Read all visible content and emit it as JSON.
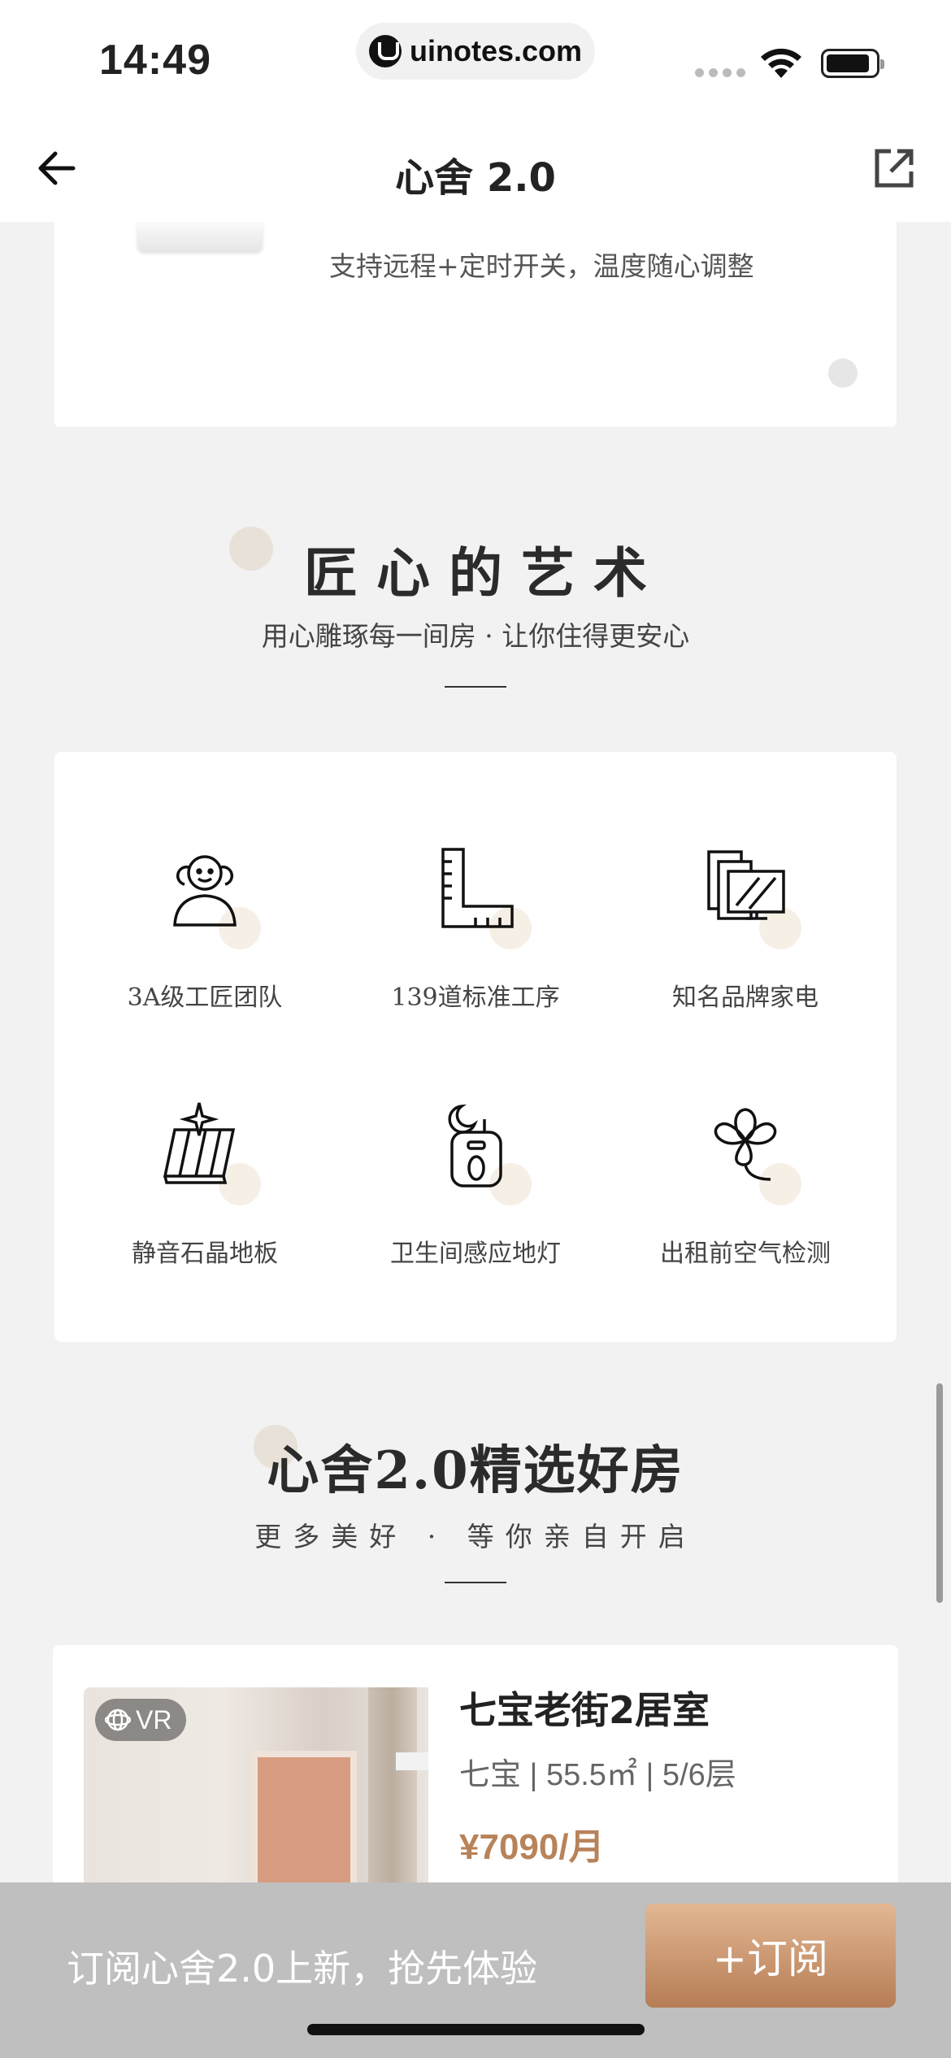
{
  "status_bar": {
    "time": "14:49",
    "url": "uinotes.com"
  },
  "nav": {
    "title": "心舍 2.0"
  },
  "ac_card": {
    "description": "支持远程+定时开关，温度随心调整"
  },
  "craft_section": {
    "title": "匠 心 的 艺 术",
    "subtitle": "用心雕琢每一间房 · 让你住得更安心"
  },
  "features": [
    {
      "label": "3A级工匠团队",
      "icon": "team-icon"
    },
    {
      "label": "139道标准工序",
      "icon": "ruler-icon"
    },
    {
      "label": "知名品牌家电",
      "icon": "appliance-icon"
    },
    {
      "label": "静音石晶地板",
      "icon": "floor-icon"
    },
    {
      "label": "卫生间感应地灯",
      "icon": "night-light-icon"
    },
    {
      "label": "出租前空气检测",
      "icon": "clover-icon"
    }
  ],
  "listings_section": {
    "title": "心舍2.0精选好房",
    "subtitle": "更多美好 · 等你亲自开启"
  },
  "listing": {
    "badge": "VR",
    "name": "七宝老街2居室",
    "meta": "七宝 | 55.5㎡ | 5/6层",
    "price": "¥7090/月"
  },
  "subscribe_bar": {
    "text": "订阅心舍2.0上新，抢先体验",
    "button": "+订阅"
  },
  "colors": {
    "accent": "#b7835a",
    "background": "#f2f2f2"
  }
}
